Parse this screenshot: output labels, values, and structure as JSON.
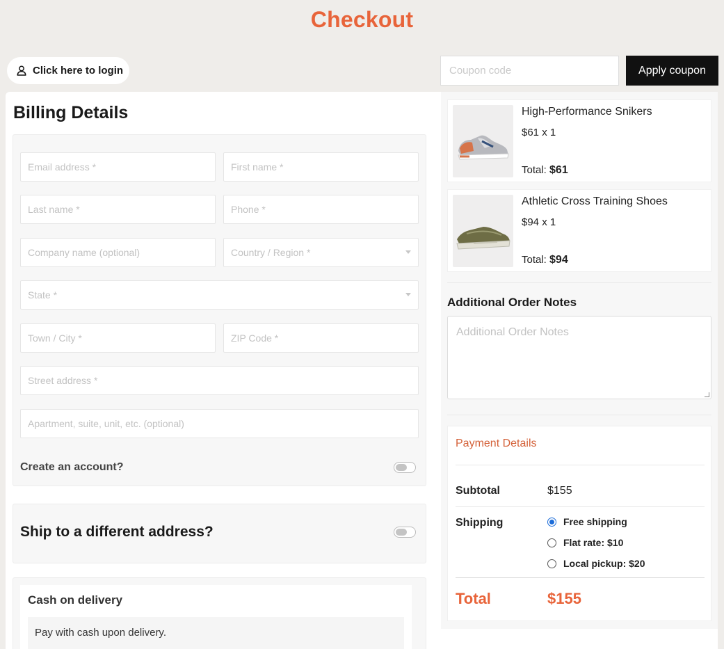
{
  "page": {
    "title": "Checkout"
  },
  "header": {
    "login_label": "Click here to login",
    "coupon_placeholder": "Coupon code",
    "apply_coupon_label": "Apply coupon"
  },
  "billing": {
    "title": "Billing Details",
    "fields": {
      "email": "Email address *",
      "first_name": "First name *",
      "last_name": "Last name *",
      "phone": "Phone *",
      "company": "Company name (optional)",
      "country": "Country / Region *",
      "state": "State *",
      "city": "Town / City *",
      "zip": "ZIP Code *",
      "street": "Street address *",
      "apartment": "Apartment, suite, unit, etc. (optional)"
    },
    "create_account_label": "Create an account?"
  },
  "shipping": {
    "label": "Ship to a different address?"
  },
  "payment_method": {
    "title": "Cash on delivery",
    "description": "Pay with cash upon delivery."
  },
  "cart": {
    "items": [
      {
        "name": "High-Performance Snikers",
        "price_qty": "$61 x 1",
        "total_label": "Total:",
        "total": "$61"
      },
      {
        "name": "Athletic Cross Training Shoes",
        "price_qty": "$94 x 1",
        "total_label": "Total:",
        "total": "$94"
      }
    ]
  },
  "notes": {
    "label": "Additional Order Notes",
    "placeholder": "Additional Order Notes"
  },
  "payment_details": {
    "title": "Payment Details",
    "subtotal_label": "Subtotal",
    "subtotal": "$155",
    "shipping_label": "Shipping",
    "shipping_options": [
      {
        "label": "Free shipping",
        "selected": true
      },
      {
        "label": "Flat rate: $10",
        "selected": false
      },
      {
        "label": "Local pickup: $20",
        "selected": false
      }
    ],
    "total_label": "Total",
    "total": "$155"
  },
  "colors": {
    "accent": "#e8643a",
    "radio": "#1a6bd8",
    "button": "#111111"
  }
}
